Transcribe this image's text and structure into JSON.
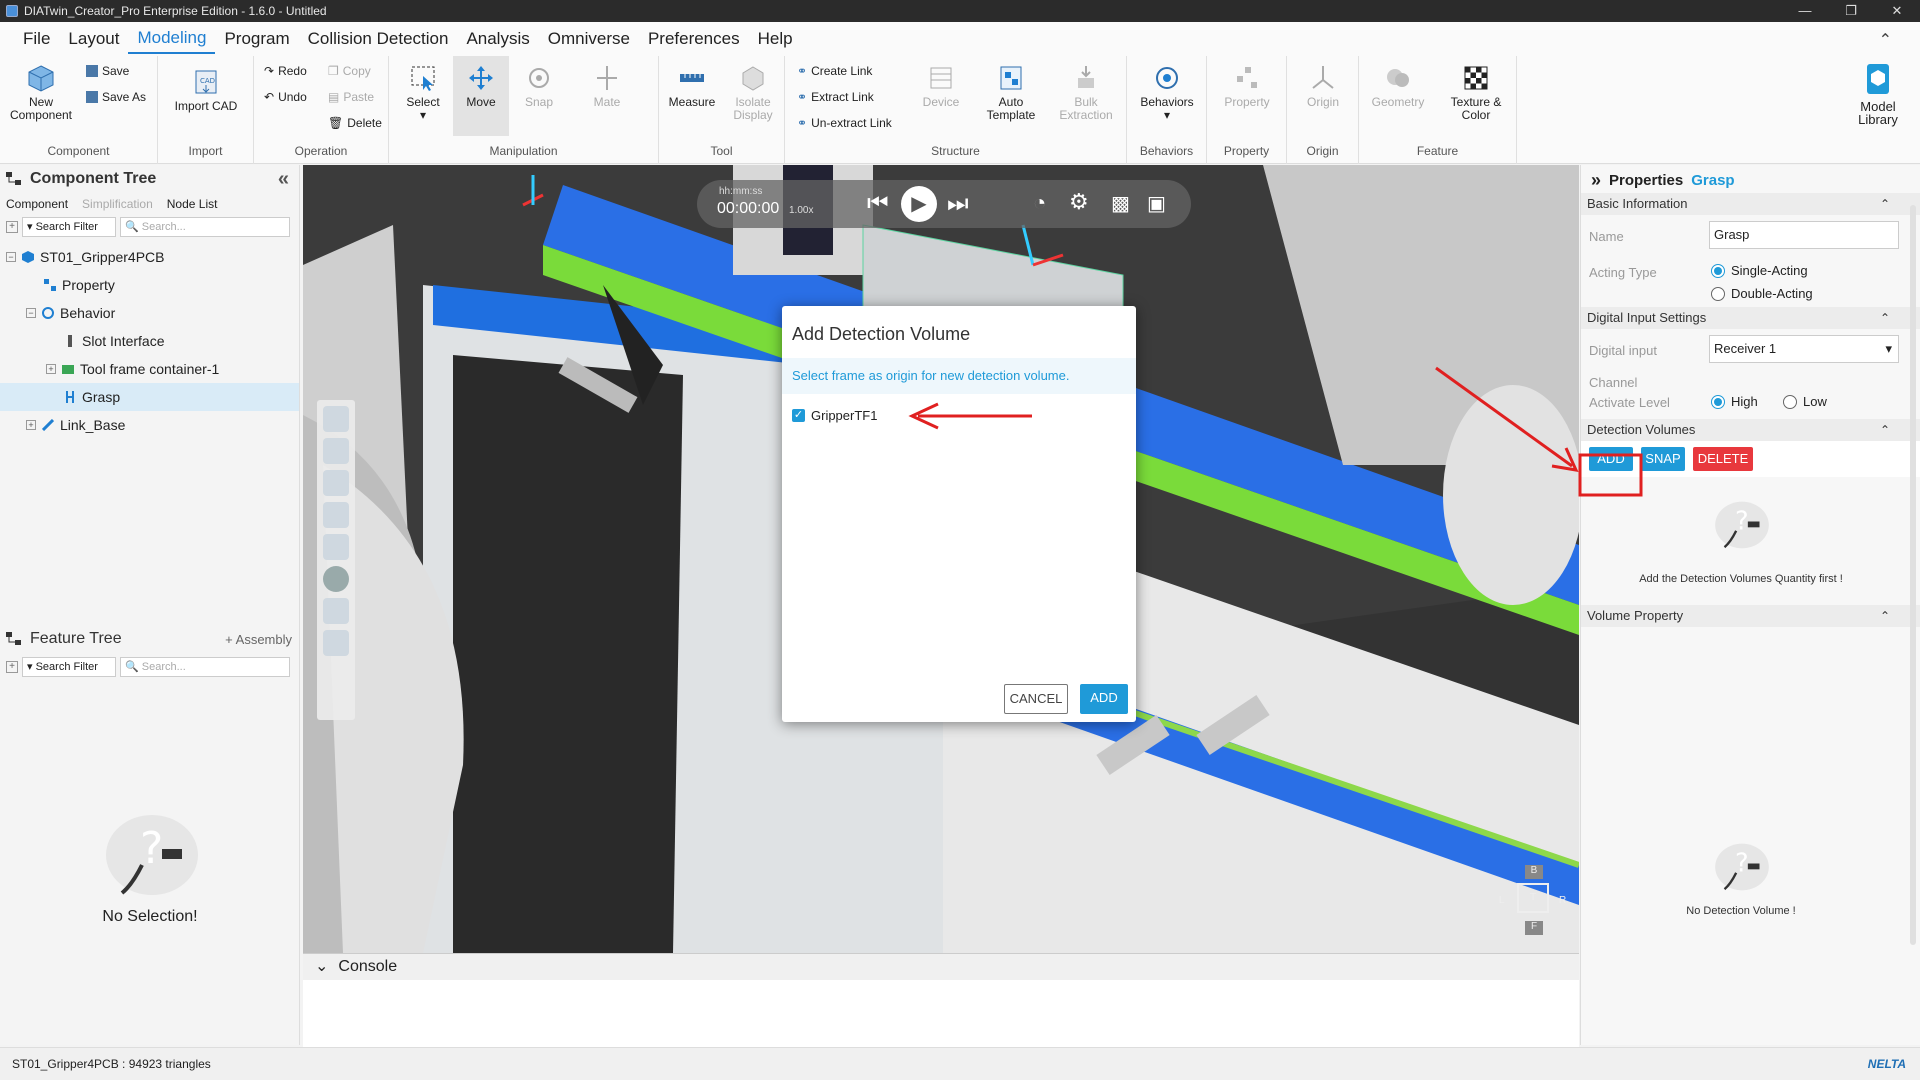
{
  "window": {
    "title": "DIATwin_Creator_Pro Enterprise Edition - 1.6.0 - Untitled"
  },
  "menu": {
    "items": [
      "File",
      "Layout",
      "Modeling",
      "Program",
      "Collision Detection",
      "Analysis",
      "Omniverse",
      "Preferences",
      "Help"
    ]
  },
  "ribbon": {
    "component": {
      "label": "Component",
      "new_component": "New Component",
      "save": "Save",
      "save_as": "Save As"
    },
    "import": {
      "label": "Import",
      "import_cad": "Import CAD"
    },
    "operation": {
      "label": "Operation",
      "redo": "Redo",
      "undo": "Undo",
      "copy": "Copy",
      "paste": "Paste",
      "delete": "Delete"
    },
    "manipulation": {
      "label": "Manipulation",
      "select": "Select",
      "move": "Move",
      "snap": "Snap",
      "mate": "Mate"
    },
    "tool": {
      "label": "Tool",
      "measure": "Measure",
      "isolate_display": "Isolate Display"
    },
    "structure": {
      "label": "Structure",
      "create_link": "Create Link",
      "extract_link": "Extract Link",
      "unextract_link": "Un-extract Link",
      "device": "Device",
      "auto_template": "Auto Template",
      "bulk_extraction": "Bulk Extraction"
    },
    "behaviors": {
      "label": "Behaviors",
      "behaviors": "Behaviors"
    },
    "property": {
      "label": "Property",
      "property": "Property"
    },
    "origin": {
      "label": "Origin",
      "origin": "Origin"
    },
    "feature": {
      "label": "Feature",
      "geometry": "Geometry",
      "texture_color": "Texture & Color"
    },
    "model_library": "Model Library"
  },
  "component_tree": {
    "title": "Component Tree",
    "tabs": [
      "Component",
      "Simplification",
      "Node List"
    ],
    "search_filter": "Search Filter",
    "search_placeholder": "Search...",
    "nodes": [
      {
        "label": "ST01_Gripper4PCB"
      },
      {
        "label": "Property"
      },
      {
        "label": "Behavior"
      },
      {
        "label": "Slot Interface"
      },
      {
        "label": "Tool frame container-1"
      },
      {
        "label": "Grasp"
      },
      {
        "label": "Link_Base"
      }
    ]
  },
  "feature_tree": {
    "title": "Feature Tree",
    "assembly": "+ Assembly",
    "search_filter": "Search Filter",
    "search_placeholder": "Search...",
    "empty": "No Selection!"
  },
  "playback": {
    "time_label": "hh:mm:ss",
    "time": "00:00:00",
    "speed": "1.00x"
  },
  "view_cube": {
    "b": "B",
    "l": "L",
    "t": "T",
    "r": "R",
    "f": "F"
  },
  "dialog": {
    "title": "Add Detection Volume",
    "info": "Select frame as origin for new detection volume.",
    "option": "GripperTF1",
    "cancel": "CANCEL",
    "add": "ADD"
  },
  "console": {
    "title": "Console"
  },
  "properties": {
    "title": "Properties",
    "object": "Grasp",
    "basic_info": "Basic Information",
    "name_label": "Name",
    "name_value": "Grasp",
    "acting_type_label": "Acting Type",
    "acting_single": "Single-Acting",
    "acting_double": "Double-Acting",
    "digital_input_settings": "Digital Input Settings",
    "digital_input_label": "Digital input",
    "digital_input_value": "Receiver 1",
    "channel_label": "Channel",
    "activate_level_label": "Activate Level",
    "level_high": "High",
    "level_low": "Low",
    "detection_volumes": "Detection Volumes",
    "btn_add": "ADD",
    "btn_snap": "SNAP",
    "btn_delete": "DELETE",
    "detection_empty": "Add the Detection Volumes Quantity first !",
    "volume_property": "Volume Property",
    "volume_empty": "No Detection Volume !"
  },
  "status": {
    "text": "ST01_Gripper4PCB : 94923 triangles",
    "brand": "NELTA"
  },
  "colors": {
    "accent": "#1f9ad8",
    "danger": "#e8383d",
    "annotation": "#e02020"
  }
}
